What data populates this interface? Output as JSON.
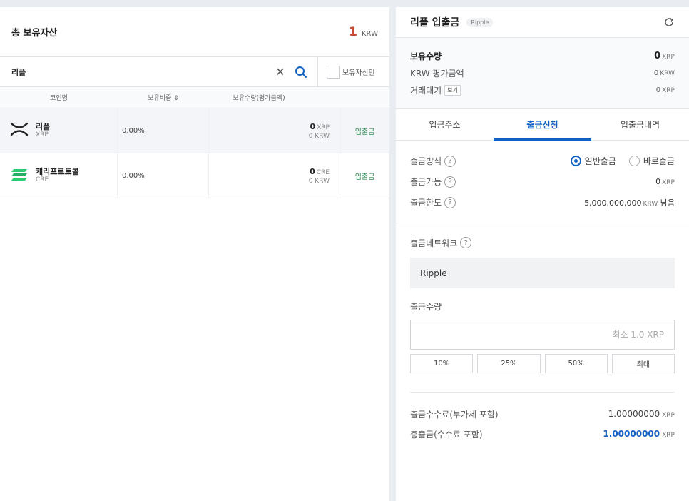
{
  "holdings": {
    "title": "총 보유자산",
    "total_value": "1",
    "total_unit": "KRW",
    "search": {
      "value": "리플",
      "owned_only_label": "보유자산만"
    },
    "columns": {
      "name": "코인명",
      "ratio": "보유비중 ⇕",
      "qty": "보유수량(평가금액)"
    },
    "coins": [
      {
        "name": "리플",
        "symbol": "XRP",
        "ratio": "0.00%",
        "qty": "0",
        "qty_unit": "XRP",
        "krw": "0 KRW",
        "action": "입출금",
        "icon": "ripple-logo-icon"
      },
      {
        "name": "캐리프로토콜",
        "symbol": "CRE",
        "ratio": "0.00%",
        "qty": "0",
        "qty_unit": "CRE",
        "krw": "0 KRW",
        "action": "입출금",
        "icon": "carry-protocol-logo-icon"
      }
    ]
  },
  "wallet": {
    "title": "리플 입출금",
    "badge": "Ripple",
    "summary": {
      "holding_label": "보유수량",
      "holding_value": "0",
      "holding_unit": "XRP",
      "krw_label": "KRW 평가금액",
      "krw_value": "0",
      "krw_unit": "KRW",
      "pending_label": "거래대기",
      "pending_btn": "보기",
      "pending_value": "0",
      "pending_unit": "XRP"
    },
    "tabs": [
      "입금주소",
      "출금신청",
      "입출금내역"
    ],
    "withdraw": {
      "method_label": "출금방식",
      "method_options": [
        "일반출금",
        "바로출금"
      ],
      "available_label": "출금가능",
      "available_value": "0",
      "available_unit": "XRP",
      "limit_label": "출금한도",
      "limit_value": "5,000,000,000",
      "limit_unit": "KRW",
      "limit_suffix": "남음",
      "network_label": "출금네트워크",
      "network_value": "Ripple",
      "amount_label": "출금수량",
      "amount_placeholder": "최소 1.0 XRP",
      "pct_buttons": [
        "10%",
        "25%",
        "50%",
        "최대"
      ],
      "fee_label": "출금수수료(부가세 포함)",
      "fee_value": "1.00000000",
      "fee_unit": "XRP",
      "total_label": "총출금(수수료 포함)",
      "total_value": "1.00000000",
      "total_unit": "XRP"
    }
  },
  "colors": {
    "accent": "#1261c4",
    "total_red": "#c84a31",
    "action_green": "#2e8b57"
  }
}
